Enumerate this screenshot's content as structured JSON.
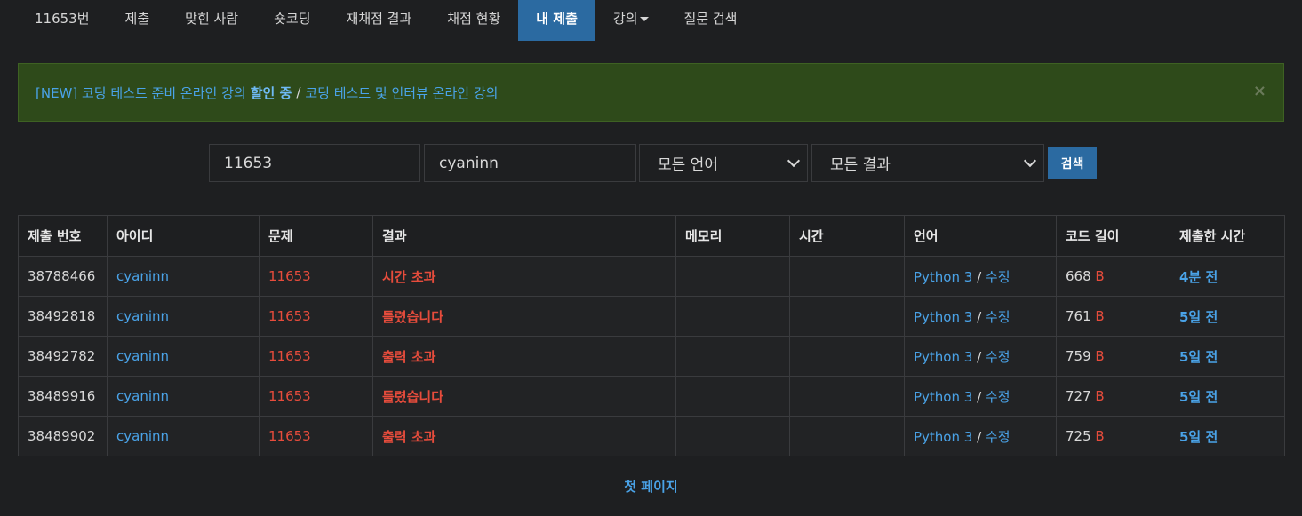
{
  "nav": {
    "items": [
      {
        "label": "11653번"
      },
      {
        "label": "제출"
      },
      {
        "label": "맞힌 사람"
      },
      {
        "label": "숏코딩"
      },
      {
        "label": "재채점 결과"
      },
      {
        "label": "채점 현황"
      },
      {
        "label": "내 제출"
      },
      {
        "label": "강의"
      },
      {
        "label": "질문 검색"
      }
    ],
    "active_index": 6
  },
  "alert": {
    "link1": "[NEW] 코딩 테스트 준비 온라인 강의",
    "highlight": "할인 중",
    "separator": "/",
    "link2": "코딩 테스트 및 인터뷰 온라인 강의",
    "close": "×"
  },
  "filter": {
    "problem_id": "11653",
    "user_id": "cyaninn",
    "language": "모든 언어",
    "result": "모든 결과",
    "search_label": "검색"
  },
  "table": {
    "headers": [
      "제출 번호",
      "아이디",
      "문제",
      "결과",
      "메모리",
      "시간",
      "언어",
      "코드 길이",
      "제출한 시간"
    ],
    "rows": [
      {
        "id": "38788466",
        "user": "cyaninn",
        "problem": "11653",
        "result": "시간 초과",
        "memory": "",
        "time": "",
        "lang": "Python 3",
        "edit": "수정",
        "length": "668",
        "unit": "B",
        "submitted": "4분 전"
      },
      {
        "id": "38492818",
        "user": "cyaninn",
        "problem": "11653",
        "result": "틀렸습니다",
        "memory": "",
        "time": "",
        "lang": "Python 3",
        "edit": "수정",
        "length": "761",
        "unit": "B",
        "submitted": "5일 전"
      },
      {
        "id": "38492782",
        "user": "cyaninn",
        "problem": "11653",
        "result": "출력 초과",
        "memory": "",
        "time": "",
        "lang": "Python 3",
        "edit": "수정",
        "length": "759",
        "unit": "B",
        "submitted": "5일 전"
      },
      {
        "id": "38489916",
        "user": "cyaninn",
        "problem": "11653",
        "result": "틀렸습니다",
        "memory": "",
        "time": "",
        "lang": "Python 3",
        "edit": "수정",
        "length": "727",
        "unit": "B",
        "submitted": "5일 전"
      },
      {
        "id": "38489902",
        "user": "cyaninn",
        "problem": "11653",
        "result": "출력 초과",
        "memory": "",
        "time": "",
        "lang": "Python 3",
        "edit": "수정",
        "length": "725",
        "unit": "B",
        "submitted": "5일 전"
      }
    ]
  },
  "pager": {
    "first_page": "첫 페이지"
  },
  "colors": {
    "accent": "#2b6aa1",
    "link": "#4aa3e8",
    "error": "#e74c3c",
    "alert_bg": "#2e4a1a"
  }
}
